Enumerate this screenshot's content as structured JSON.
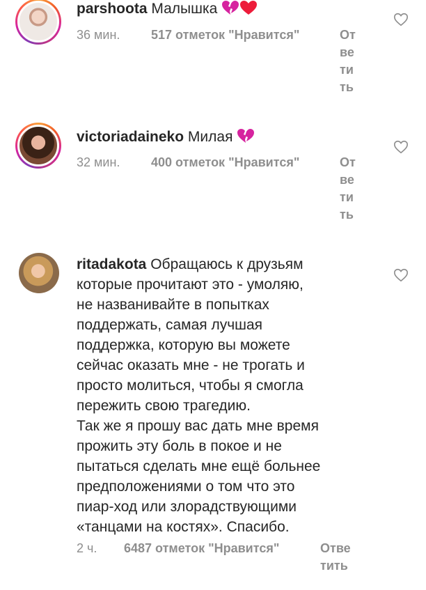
{
  "comments": [
    {
      "username": "parshoota",
      "text": "Малышка",
      "emojis": [
        "broken-heart-emoji",
        "red-heart-emoji"
      ],
      "time": "36 мин.",
      "likes": "517 отметок \"Нравится\"",
      "reply_lines": [
        "От",
        "ве",
        "ти",
        "ть"
      ]
    },
    {
      "username": "victoriadaineko",
      "text": "Милая",
      "emojis": [
        "broken-heart-emoji"
      ],
      "time": "32 мин.",
      "likes": "400 отметок \"Нравится\"",
      "reply_lines": [
        "От",
        "ве",
        "ти",
        "ть"
      ]
    },
    {
      "username": "ritadakota",
      "lines": [
        "Обращаюсь к друзьям",
        "которые прочитают это - умоляю,",
        "не названивайте в попытках",
        "поддержать, самая лучшая",
        "поддержка, которую вы можете",
        "сейчас оказать мне - не трогать  и",
        "просто молиться, чтобы я смогла",
        "пережить свою трагедию.",
        "Так же я прошу вас дать мне время",
        "прожить эту боль в покое и не",
        "пытаться сделать мне ещё больнее",
        "предположениями о том что это",
        "пиар-ход или злорадствующими",
        "«танцами на костях». Спасибо."
      ],
      "time": "2 ч.",
      "likes": "6487 отметок \"Нравится\"",
      "reply_lines": [
        "Отве",
        "тить"
      ]
    }
  ],
  "colors": {
    "text": "#262626",
    "muted": "#8e8e8e",
    "broken_heart": "#d6249f",
    "red_heart": "#ed1c3a"
  }
}
